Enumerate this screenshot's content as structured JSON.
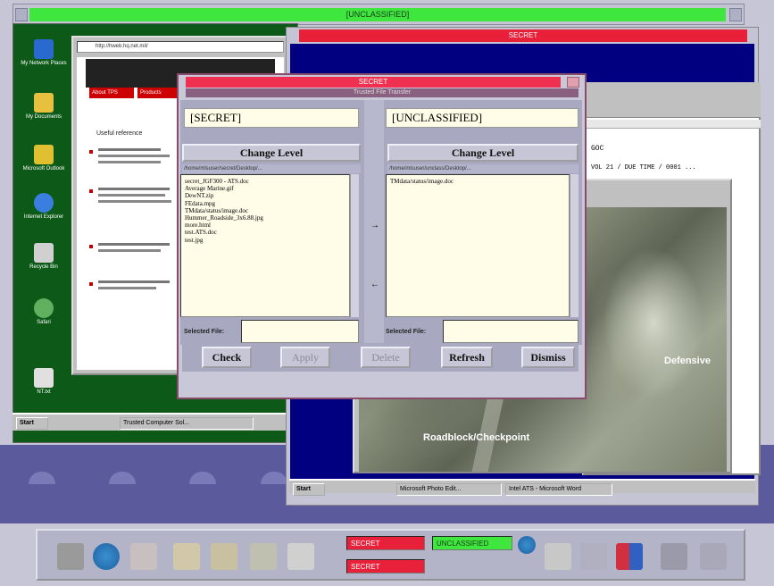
{
  "cde": {
    "top_banner_label": "[UNCLASSIFIED]",
    "colors": {
      "unclassified": "#3ee63e",
      "secret": "#e8203a"
    }
  },
  "left_desktop": {
    "icons": [
      {
        "label": "My Network Places",
        "icon": "network-icon",
        "color": "#2a6ad0"
      },
      {
        "label": "My Documents",
        "icon": "folder-icon",
        "color": "#e8c040"
      },
      {
        "label": "Microsoft Outlook",
        "icon": "outlook-icon",
        "color": "#e0c030"
      },
      {
        "label": "Internet Explorer",
        "icon": "ie-icon",
        "color": "#3a7ee0"
      },
      {
        "label": "Recycle Bin",
        "icon": "recycle-bin-icon",
        "color": "#d0d0d0"
      },
      {
        "label": "Safari",
        "icon": "globe-icon",
        "color": "#60b060"
      },
      {
        "label": "NT.txt",
        "icon": "text-file-icon",
        "color": "#e0e0e0"
      }
    ],
    "browser": {
      "address": "http://hweb.hq.net.mil/",
      "tab1": "About TPS",
      "tab2": "Products",
      "heading": "Useful reference"
    },
    "taskbar": {
      "start": "Start",
      "task": "Trusted Computer Sol..."
    }
  },
  "right_session": {
    "title": "SECRET",
    "map_label_1": "Roadblock/Checkpoint",
    "map_label_2": "Defensive",
    "doc_code": "GOC",
    "doc_line": "VOL 21 / DUE TIME / 0001 ...",
    "taskbar": {
      "start": "Start",
      "task1": "Microsoft Photo Edit...",
      "task2": "Intel ATS - Microsoft Word"
    }
  },
  "dialog": {
    "title": "SECRET",
    "subtitle": "Trusted File Transfer",
    "left": {
      "level_label": "[SECRET]",
      "change_level": "Change Level",
      "path": "/home/mlsuser/secret/Desktop/...",
      "files": [
        "secret_JGF300 - ATS.doc",
        "Average Marine.gif",
        "DewNT.zip",
        "FEdata.mpg",
        "TMdata/status/image.doc",
        "Hummer_Roadside_3x6.88.jpg",
        "more.html",
        "test.ATS.doc",
        "test.jpg"
      ],
      "selected_label": "Selected File:",
      "selected_value": ""
    },
    "right": {
      "level_label": "[UNCLASSIFIED]",
      "change_level": "Change Level",
      "path": "/home/mlsuser/unclass/Desktop/...",
      "files": [
        "TMdata/status/image.doc"
      ],
      "selected_label": "Selected File:",
      "selected_value": ""
    },
    "arrow_right": "→",
    "arrow_left": "←",
    "buttons": {
      "check": "Check",
      "apply": "Apply",
      "delete": "Delete",
      "refresh": "Refresh",
      "dismiss": "Dismiss"
    }
  },
  "front_panel": {
    "status_top_left": "SECRET",
    "status_top_right": "UNCLASSIFIED",
    "status_bottom_left": "SECRET"
  }
}
